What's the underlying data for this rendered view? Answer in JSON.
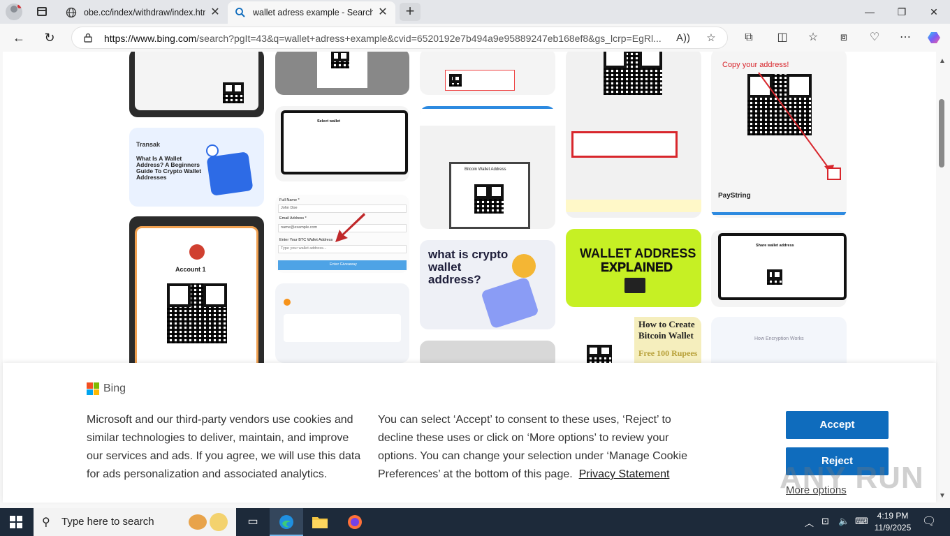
{
  "browser": {
    "tabs": [
      {
        "title": "obe.cc/index/withdraw/index.htm"
      },
      {
        "title": "wallet adress example - Search"
      }
    ],
    "new_tab_label": "+",
    "window_controls": {
      "minimize": "—",
      "restore": "❐",
      "close": "✕"
    },
    "url_host": "https://www.bing.com",
    "url_path": "/search?pgIt=43&q=wallet+adress+example&cvid=6520192e7b494a9e95889247eb168ef8&gs_lcrp=EgRl..."
  },
  "results": {
    "tile_texts": {
      "transak_brand": "Transak",
      "transak_headline": "What Is A Wallet Address? A Beginners Guide To Crypto Wallet Addresses",
      "account": "Account 1",
      "fullname_label": "Full Name *",
      "fullname_value": "John Doe",
      "email_label": "Email Address *",
      "email_value": "name@example.com",
      "btc_label": "Enter Your BTC Wallet Address",
      "btc_placeholder": "Type your wallet address...",
      "enter_button": "Enter Giveaway",
      "crypto_q": "what is crypto wallet address?",
      "explained_1": "WALLET ADDRESS",
      "explained_2": "EXPLAINED",
      "copy_address": "Copy your address!",
      "paystring": "PayString",
      "bitcoin_wallet": "Bitcoin Wallet Address",
      "create_1": "How to Create",
      "create_2": "Bitcoin Wallet",
      "create_3": "Free 100 Rupees",
      "encryption": "How Encryption Works",
      "select_wallet": "Select wallet",
      "share_wallet": "Share wallet address"
    }
  },
  "cookie_banner": {
    "brand": "Bing",
    "text_left": "Microsoft and our third-party vendors use cookies and similar technologies to deliver, maintain, and improve our services and ads. If you agree, we will use this data for ads personalization and associated analytics.",
    "text_right": "You can select ‘Accept’ to consent to these uses, ‘Reject’ to decline these uses or click on ‘More options’ to review your options. You can change your selection under ‘Manage Cookie Preferences’ at the bottom of this page.",
    "privacy_link": "Privacy Statement",
    "accept": "Accept",
    "reject": "Reject",
    "more_options": "More options",
    "watermark": "ANY RUN"
  },
  "taskbar": {
    "search_placeholder": "Type here to search",
    "time": "4:19 PM",
    "date": "11/9/2025"
  },
  "colors": {
    "accent": "#0f6cbd",
    "taskbar": "#1d2a3a",
    "tab_bar": "#e4e6ea"
  }
}
